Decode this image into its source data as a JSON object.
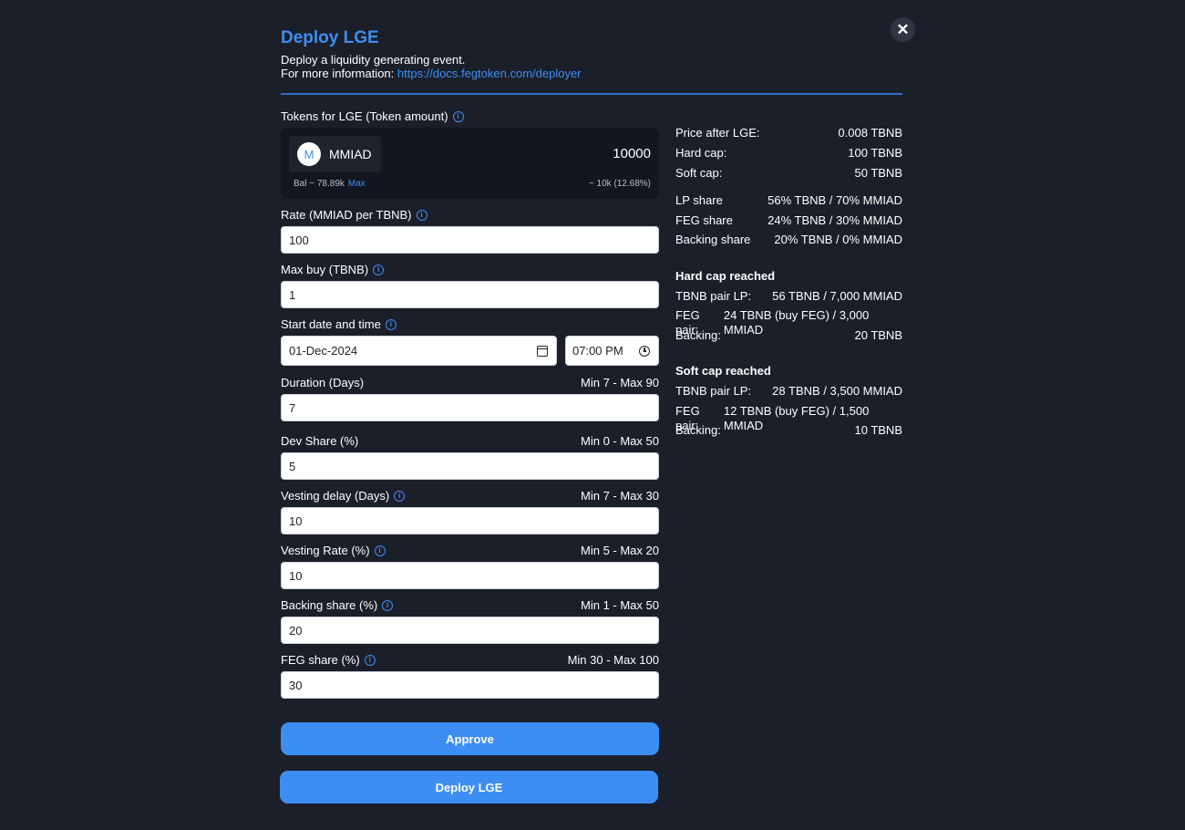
{
  "close_label": "✕",
  "header": {
    "title": "Deploy LGE",
    "subtitle": "Deploy a liquidity generating event.",
    "info_prefix": "For more information:",
    "info_link": "https://docs.fegtoken.com/deployer"
  },
  "tokens": {
    "label": "Tokens for LGE (Token amount)",
    "symbol": "MMIAD",
    "avatar_letter": "M",
    "amount": "10000",
    "balance": "Bal ~ 78.89k",
    "max_label": "Max",
    "usd": "~ 10k (12.68%)"
  },
  "fields": {
    "rate": {
      "label": "Rate (MMIAD per TBNB)",
      "value": "100"
    },
    "max_buy": {
      "label": "Max buy (TBNB)",
      "value": "1"
    },
    "start": {
      "label": "Start date and time",
      "date": "01-Dec-2024",
      "time": "07:00 PM"
    },
    "duration": {
      "label": "Duration (Days)",
      "range": "Min 7 - Max 90",
      "value": "7"
    },
    "dev_share": {
      "label": "Dev Share (%)",
      "range": "Min 0 - Max 50",
      "value": "5"
    },
    "vesting_delay": {
      "label": "Vesting delay (Days)",
      "range": "Min 7 - Max 30",
      "value": "10"
    },
    "vesting_rate": {
      "label": "Vesting Rate (%)",
      "range": "Min 5 - Max 20",
      "value": "10"
    },
    "backing_share": {
      "label": "Backing share (%)",
      "range": "Min 1 - Max 50",
      "value": "20"
    },
    "feg_share": {
      "label": "FEG share (%)",
      "range": "Min 30 - Max 100",
      "value": "30"
    }
  },
  "buttons": {
    "approve": "Approve",
    "deploy": "Deploy LGE"
  },
  "summary": {
    "price_label": "Price after LGE:",
    "price_value": "0.008 TBNB",
    "hardcap_label": "Hard cap:",
    "hardcap_value": "100 TBNB",
    "softcap_label": "Soft cap:",
    "softcap_value": "50 TBNB",
    "lp_label": "LP share",
    "lp_value": "56% TBNB / 70% MMIAD",
    "feg_label": "FEG share",
    "feg_value": "24% TBNB / 30% MMIAD",
    "backing_label": "Backing share",
    "backing_value": "20% TBNB / 0% MMIAD"
  },
  "hard_cap": {
    "title": "Hard cap reached",
    "pair_lp_label": "TBNB pair LP:",
    "pair_lp_value": "56 TBNB / 7,000 MMIAD",
    "feg_pair_label": "FEG pair:",
    "feg_pair_value": "24 TBNB (buy FEG) / 3,000 MMIAD",
    "backing_label": "Backing:",
    "backing_value": "20 TBNB"
  },
  "soft_cap": {
    "title": "Soft cap reached",
    "pair_lp_label": "TBNB pair LP:",
    "pair_lp_value": "28 TBNB / 3,500 MMIAD",
    "feg_pair_label": "FEG pair:",
    "feg_pair_value": "12 TBNB (buy FEG) / 1,500 MMIAD",
    "backing_label": "Backing:",
    "backing_value": "10 TBNB"
  },
  "icons": [
    "close-icon",
    "info-icon",
    "calendar-icon",
    "clock-icon"
  ],
  "colors": {
    "background": "#1b1f2a",
    "accent": "#3d8ef3",
    "panel": "#121620"
  }
}
